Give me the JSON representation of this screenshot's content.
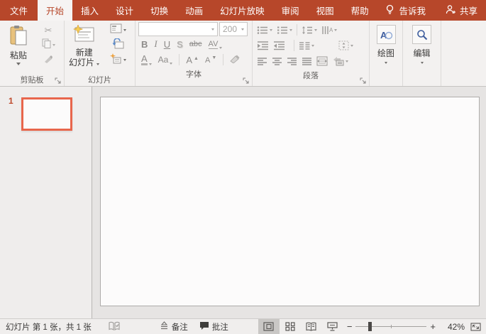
{
  "tabbar": {
    "file": "文件",
    "tabs": [
      "开始",
      "插入",
      "设计",
      "切换",
      "动画",
      "幻灯片放映",
      "审阅",
      "视图",
      "帮助"
    ],
    "active_tab": "开始",
    "tell_me": "告诉我",
    "share": "共享"
  },
  "ribbon": {
    "clipboard": {
      "group_label": "剪贴板",
      "paste_label": "粘贴",
      "cut_glyph": "✂"
    },
    "slides": {
      "group_label": "幻灯片",
      "new_slide_line1": "新建",
      "new_slide_line2": "幻灯片"
    },
    "font": {
      "group_label": "字体",
      "font_name": "",
      "font_size": "200",
      "bold": "B",
      "italic": "I",
      "underline": "U",
      "shadow": "S",
      "strikethrough": "abc",
      "char_spacing": "AV",
      "font_color": "A",
      "change_case": "Aa",
      "grow_font": "A",
      "shrink_font": "A"
    },
    "paragraph": {
      "group_label": "段落"
    },
    "drawing": {
      "group_label": "绘图",
      "icon_letter": "A"
    },
    "editing": {
      "group_label": "编辑"
    }
  },
  "slides_panel": {
    "slide_number": "1"
  },
  "statusbar": {
    "slide_info": "幻灯片 第 1 张，共 1 张",
    "notes_label": "备注",
    "comments_label": "批注",
    "zoom_minus": "−",
    "zoom_plus": "+",
    "zoom_value": "42%"
  },
  "colors": {
    "accent": "#B7472A",
    "thumbnail_border": "#E8664C"
  }
}
